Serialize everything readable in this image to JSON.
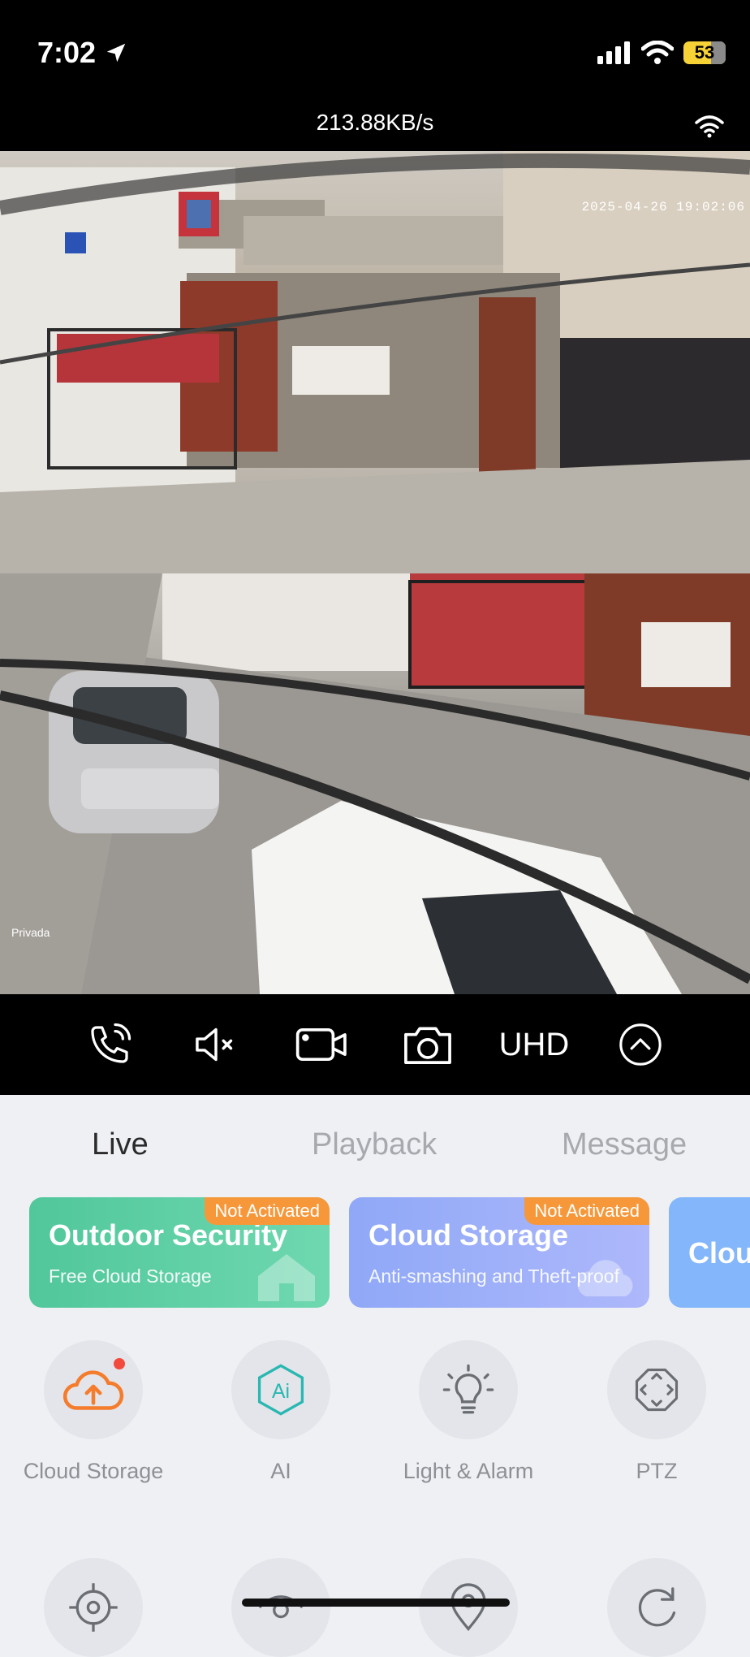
{
  "status_bar": {
    "time": "7:02",
    "battery": "53",
    "icons": [
      "location-arrow-icon",
      "cellular-signal-icon",
      "wifi-icon",
      "battery-icon"
    ]
  },
  "stream": {
    "rate": "213.88KB/s",
    "overlay_timestamp": "2025-04-26 19:02:06",
    "overlay_label": "Privada"
  },
  "controls": {
    "items": [
      "phone-call-icon",
      "mute-speaker-icon",
      "record-video-icon",
      "snapshot-camera-icon",
      "quality",
      "collapse-up-icon"
    ],
    "quality_label": "UHD"
  },
  "tabs": [
    {
      "label": "Live",
      "active": true
    },
    {
      "label": "Playback",
      "active": false
    },
    {
      "label": "Message",
      "active": false
    }
  ],
  "promo_cards": [
    {
      "title": "Outdoor Security",
      "subtitle": "Free Cloud Storage",
      "badge": "Not Activated",
      "color": "#51c79b"
    },
    {
      "title": "Cloud Storage",
      "subtitle": "Anti-smashing and Theft-proof",
      "badge": "Not Activated",
      "color": "#8fa8f7"
    },
    {
      "title": "Clou",
      "color": "#83b6fb"
    }
  ],
  "tools": [
    {
      "label": "Cloud Storage",
      "icon": "cloud-upload-icon",
      "has_notification": true
    },
    {
      "label": "AI",
      "icon": "ai-icon",
      "has_notification": false
    },
    {
      "label": "Light & Alarm",
      "icon": "light-bulb-icon",
      "has_notification": false
    },
    {
      "label": "PTZ",
      "icon": "ptz-direction-icon",
      "has_notification": false
    }
  ],
  "colors": {
    "accent": "#22b3b5",
    "badge": "#f6983a",
    "cloud_icon": "#f47c2c",
    "ai_icon": "#2ab7b1"
  }
}
